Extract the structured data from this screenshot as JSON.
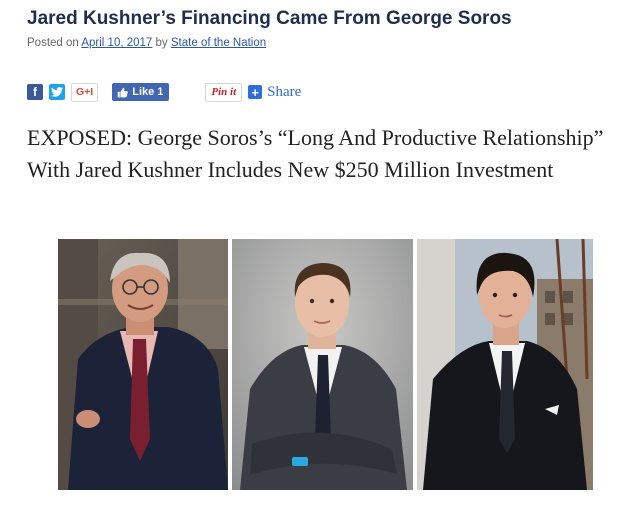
{
  "post": {
    "title": "Jared Kushner’s Financing Came From George Soros",
    "posted_on_label": "Posted on",
    "date": "April 10, 2017",
    "by_label": "by",
    "author": "State of the Nation"
  },
  "share_bar": {
    "facebook_glyph": "f",
    "gplus_label": "G+I",
    "like_label": "Like 1",
    "pin_label": "Pin it",
    "plus_glyph": "+",
    "share_label": "Share"
  },
  "headline": "EXPOSED: George Soros’s “Long And Productive Relationship” With Jared Kushner Includes New $250 Million Investment",
  "images": [
    {
      "icon": "photo-george-soros"
    },
    {
      "icon": "photo-jared-kushner"
    },
    {
      "icon": "photo-joshua-kushner"
    }
  ],
  "colors": {
    "title": "#1e2f4d",
    "link": "#2b5aa3",
    "facebook": "#3b5998",
    "twitter": "#1da1f2",
    "like": "#4267b2",
    "pinterest": "#cb2027",
    "share": "#2f6edb"
  }
}
